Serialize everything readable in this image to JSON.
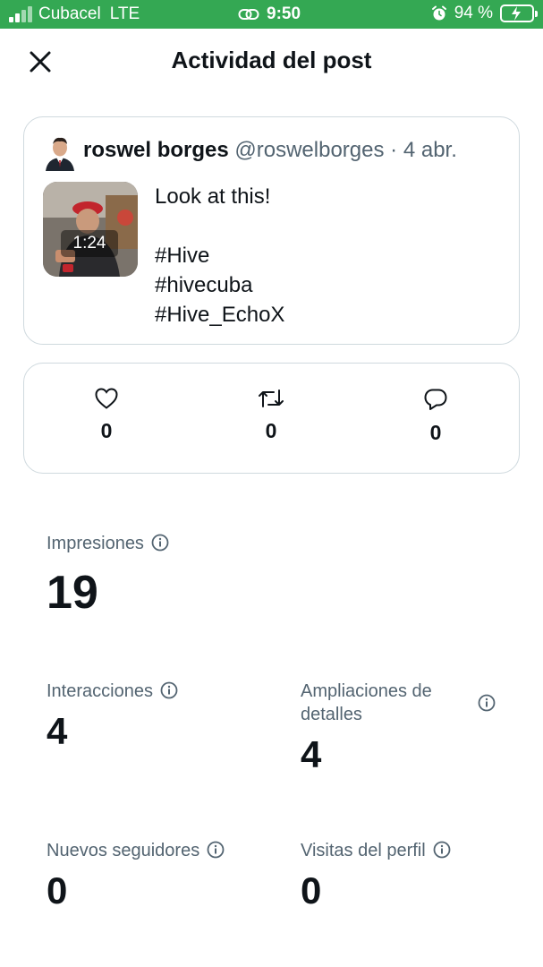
{
  "status_bar": {
    "carrier": "Cubacel",
    "network": "LTE",
    "time": "9:50",
    "battery": "94 %"
  },
  "header": {
    "title": "Actividad del post"
  },
  "post": {
    "author_name": "roswel borges",
    "author_handle": "@roswelborges",
    "separator": "·",
    "date": "4 abr.",
    "video_duration": "1:24",
    "text_lines": [
      "Look at this!",
      "",
      "#Hive",
      "#hivecuba",
      "#Hive_EchoX"
    ]
  },
  "engagement": {
    "likes": "0",
    "reposts": "0",
    "replies": "0"
  },
  "metrics": {
    "impressions": {
      "label": "Impresiones",
      "value": "19"
    },
    "interactions": {
      "label": "Interacciones",
      "value": "4"
    },
    "detail_expands": {
      "label": "Ampliaciones de detalles",
      "value": "4"
    },
    "new_followers": {
      "label": "Nuevos seguidores",
      "value": "0"
    },
    "profile_visits": {
      "label": "Visitas del perfil",
      "value": "0"
    }
  },
  "colors": {
    "status_bar_bg": "#34a853",
    "text_primary": "#0f1419",
    "text_secondary": "#536471",
    "border": "#cfd9de"
  },
  "icons": {
    "close": "close-icon",
    "like": "heart-icon",
    "repost": "repost-icon",
    "reply": "reply-icon",
    "info": "info-icon"
  }
}
